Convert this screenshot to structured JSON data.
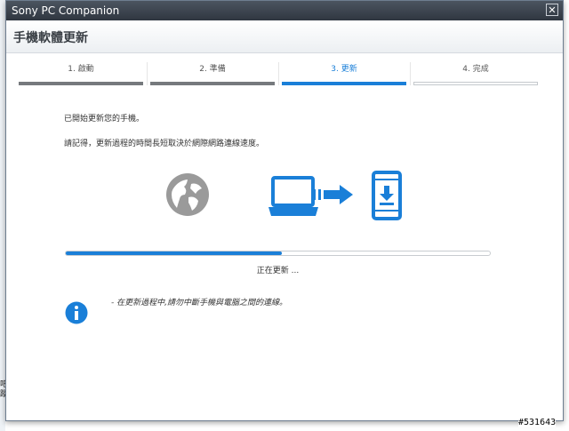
{
  "window": {
    "title": "Sony PC Companion"
  },
  "header": {
    "title": "手機軟體更新"
  },
  "steps": [
    {
      "label": "1. 啟動",
      "state": "done"
    },
    {
      "label": "2. 準備",
      "state": "done"
    },
    {
      "label": "3. 更新",
      "state": "active"
    },
    {
      "label": "4. 完成",
      "state": "pending"
    }
  ],
  "content": {
    "line1": "已開始更新您的手機。",
    "line2": "請記得，更新過程的時間長短取決於網際網路連線速度。"
  },
  "progress": {
    "fraction": 0.51,
    "status": "正在更新 ..."
  },
  "info": {
    "text": "- 在更新過程中,請勿中斷手機與電腦之間的連線。"
  },
  "icons": [
    "globe-icon",
    "laptop-icon",
    "transfer-arrow-icon",
    "phone-download-icon",
    "info-icon",
    "close-icon"
  ],
  "colors": {
    "accent": "#1a7fd8",
    "globe": "#9a9a9a",
    "titlebar": "#3a424c"
  },
  "watermark": "#531643"
}
